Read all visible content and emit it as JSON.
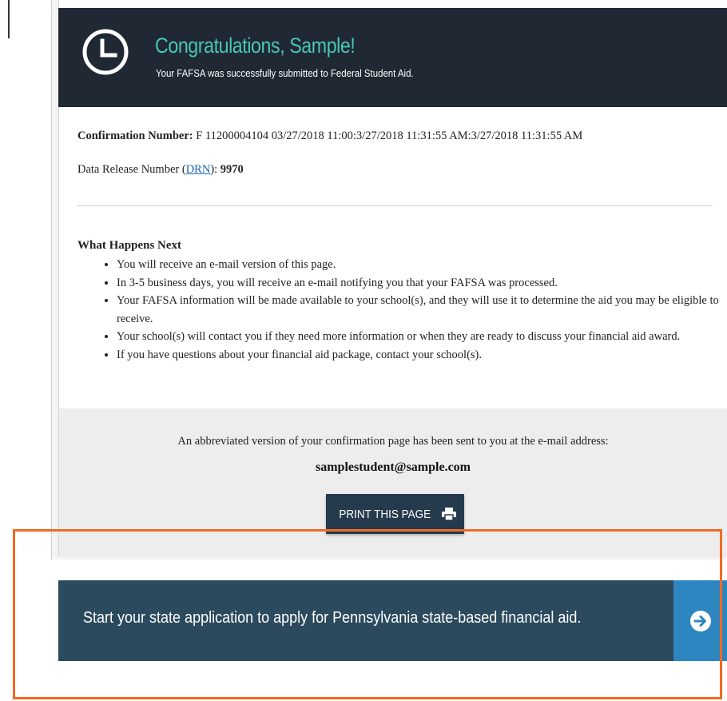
{
  "banner": {
    "title": "Congratulations, Sample!",
    "subtitle": "Your FAFSA was successfully submitted to Federal Student Aid.",
    "icon": "clock-icon",
    "accent_color": "#49c6b4",
    "background": "#1f2833"
  },
  "confirmation": {
    "label": "Confirmation Number:",
    "value": " F 11200004104 03/27/2018 11:00:3/27/2018 11:31:55 AM:3/27/2018 11:31:55 AM"
  },
  "drn": {
    "prefix": "Data Release Number (",
    "link": "DRN",
    "suffix": "): ",
    "value": "9970"
  },
  "next_steps": {
    "title": "What Happens Next",
    "items": [
      "You will receive an e-mail version of this page.",
      "In 3-5 business days, you will receive an e-mail notifying you that your FAFSA was processed.",
      "Your FAFSA information will be made available to your school(s), and they will use it to determine the aid you may be eligible to receive.",
      "Your school(s) will contact you if they need more information or when they are ready to discuss your financial aid award.",
      "If you have questions about your financial aid package, contact your school(s)."
    ]
  },
  "email_notice": {
    "message": "An abbreviated version of your confirmation page has been sent to you at the e-mail address:",
    "address": "samplestudent@sample.com"
  },
  "print_button": {
    "label": "PRINT THIS PAGE",
    "icon": "printer-icon"
  },
  "state_application": {
    "text": "Start your state application to apply for Pennsylvania state-based financial aid.",
    "icon": "arrow-right-circle-icon",
    "background": "#2c4a5e",
    "arrow_background": "#2e86c1"
  },
  "highlight_color": "#f26a21"
}
